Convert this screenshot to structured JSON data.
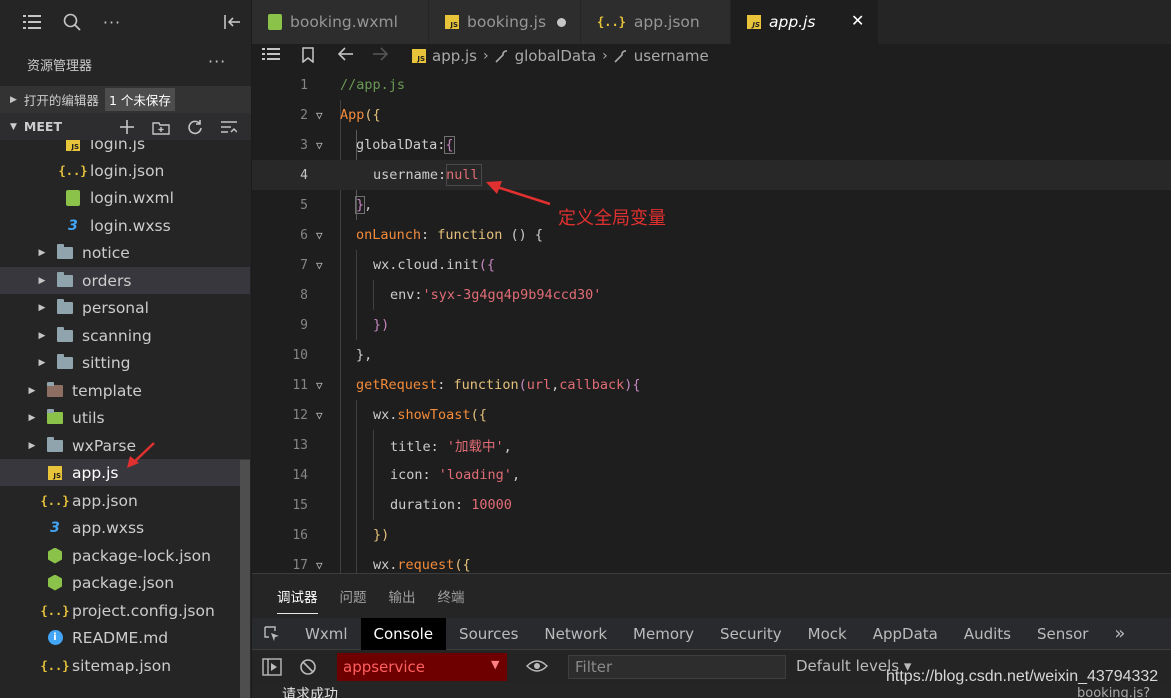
{
  "sidebar": {
    "explorer_title": "资源管理器",
    "more": "···",
    "open_editors": {
      "label": "打开的编辑器",
      "unsaved": "1 个未保存"
    },
    "project": {
      "label": "MEET"
    },
    "tree": [
      {
        "label": "login.js",
        "icon": "js"
      },
      {
        "label": "login.json",
        "icon": "json"
      },
      {
        "label": "login.wxml",
        "icon": "wxml"
      },
      {
        "label": "login.wxss",
        "icon": "css"
      },
      {
        "label": "notice",
        "icon": "folder"
      },
      {
        "label": "orders",
        "icon": "folder"
      },
      {
        "label": "personal",
        "icon": "folder"
      },
      {
        "label": "scanning",
        "icon": "folder"
      },
      {
        "label": "sitting",
        "icon": "folder"
      },
      {
        "label": "template",
        "icon": "folder"
      },
      {
        "label": "utils",
        "icon": "folder"
      },
      {
        "label": "wxParse",
        "icon": "folder"
      },
      {
        "label": "app.js",
        "icon": "js"
      },
      {
        "label": "app.json",
        "icon": "json"
      },
      {
        "label": "app.wxss",
        "icon": "css"
      },
      {
        "label": "package-lock.json",
        "icon": "node"
      },
      {
        "label": "package.json",
        "icon": "node"
      },
      {
        "label": "project.config.json",
        "icon": "json"
      },
      {
        "label": "README.md",
        "icon": "info"
      },
      {
        "label": "sitemap.json",
        "icon": "json"
      }
    ]
  },
  "tabs": [
    {
      "label": "booking.wxml",
      "icon": "wxml"
    },
    {
      "label": "booking.js",
      "icon": "js",
      "dirty": true
    },
    {
      "label": "app.json",
      "icon": "json"
    },
    {
      "label": "app.js",
      "icon": "js",
      "active": true
    }
  ],
  "breadcrumb": {
    "file": "app.js",
    "seg1": "globalData",
    "seg2": "username"
  },
  "editor": {
    "lines": [
      {
        "n": "1"
      },
      {
        "n": "2"
      },
      {
        "n": "3"
      },
      {
        "n": "4"
      },
      {
        "n": "5"
      },
      {
        "n": "6"
      },
      {
        "n": "7"
      },
      {
        "n": "8"
      },
      {
        "n": "9"
      },
      {
        "n": "10"
      },
      {
        "n": "11"
      },
      {
        "n": "12"
      },
      {
        "n": "13"
      },
      {
        "n": "14"
      },
      {
        "n": "15"
      },
      {
        "n": "16"
      },
      {
        "n": "17"
      }
    ],
    "tokens": {
      "l1": "//app.js",
      "l2_app": "App",
      "l2_paren": "({",
      "l3_key": "globalData",
      "l3_colon": ":",
      "l3_brace": "{",
      "l4_key": "username",
      "l4_colon": ":",
      "l4_val": "null",
      "l5_brace": "}",
      "l5_comma": ",",
      "l6_key": "onLaunch",
      "l6_colon": ": ",
      "l6_fn": "function",
      "l6_rest": " () {",
      "l7_obj": "wx",
      "l7_dot1": ".",
      "l7_p1": "cloud",
      "l7_dot2": ".",
      "l7_p2": "init",
      "l7_paren": "({",
      "l8_key": "env",
      "l8_colon": ":",
      "l8_val": "'syx-3g4gq4p9b94ccd30'",
      "l9_close": "})",
      "l10": "},",
      "l11_key": "getRequest",
      "l11_colon": ": ",
      "l11_fn": "function",
      "l11_open": "(",
      "l11_a1": "url",
      "l11_comma": ",",
      "l11_a2": "callback",
      "l11_close": "){",
      "l12_obj": "wx",
      "l12_dot": ".",
      "l12_fn": "showToast",
      "l12_paren": "({",
      "l13_key": "title",
      "l13_colon": ": ",
      "l13_val": "'加载中'",
      "l13_comma": ",",
      "l14_key": "icon",
      "l14_colon": ": ",
      "l14_val": "'loading'",
      "l14_comma": ",",
      "l15_key": "duration",
      "l15_colon": ": ",
      "l15_val": "10000",
      "l16_close": "})",
      "l17_obj": "wx",
      "l17_dot": ".",
      "l17_fn": "request",
      "l17_paren": "({"
    },
    "annotation": "定义全局变量"
  },
  "panel": {
    "tabs": [
      "调试器",
      "问题",
      "输出",
      "终端"
    ],
    "devtools_tabs": [
      "Wxml",
      "Console",
      "Sources",
      "Network",
      "Memory",
      "Security",
      "Mock",
      "AppData",
      "Audits",
      "Sensor"
    ],
    "devtools_more": "»",
    "context": "appservice",
    "filter_placeholder": "Filter",
    "levels": "Default levels ▾",
    "console_output": "请求成功",
    "source_link": "booking.js?"
  },
  "watermark": "https://blog.csdn.net/weixin_43794332",
  "colors": {
    "annotation": "#e03030",
    "accent_red_bg": "#6e0000",
    "js_icon": "#e8c43a",
    "css_icon": "#42a5f5"
  }
}
